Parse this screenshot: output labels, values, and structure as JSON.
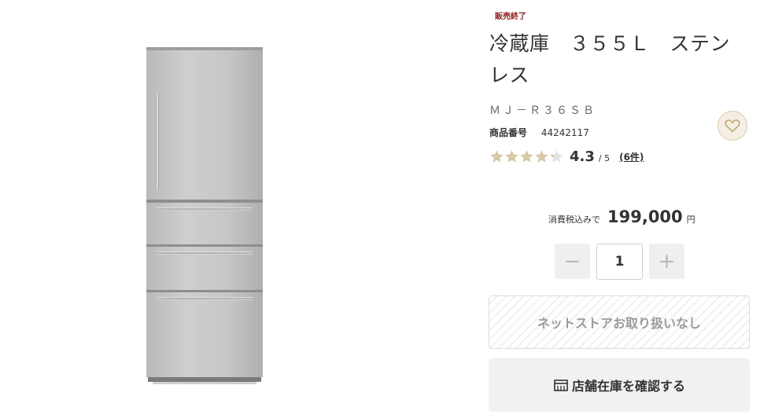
{
  "product": {
    "status_badge": "販売終了",
    "title": "冷蔵庫　３５５Ｌ　ステンレス",
    "model": "ＭＪ－Ｒ３６ＳＢ",
    "product_number_label": "商品番号",
    "product_number": "44242117",
    "image_alt": "冷蔵庫"
  },
  "rating": {
    "score": "4.3",
    "out_of": "/ 5",
    "review_count": "(6件)",
    "value": 4.3,
    "max": 5
  },
  "price": {
    "label": "消費税込みで",
    "value": "199,000",
    "unit": "円"
  },
  "quantity": {
    "value": "1",
    "minus_symbol": "−",
    "plus_symbol": "+"
  },
  "actions": {
    "not_available": "ネットストアお取り扱いなし",
    "check_store_stock": "店舗在庫を確認する"
  },
  "icons": {
    "favorite": "heart-icon",
    "store": "store-icon",
    "star": "star-icon"
  },
  "colors": {
    "badge": "#8a1a1a",
    "star_filled": "#d8c8a3",
    "star_empty": "#e3e3e3",
    "favorite_bg": "#f5efe3"
  }
}
